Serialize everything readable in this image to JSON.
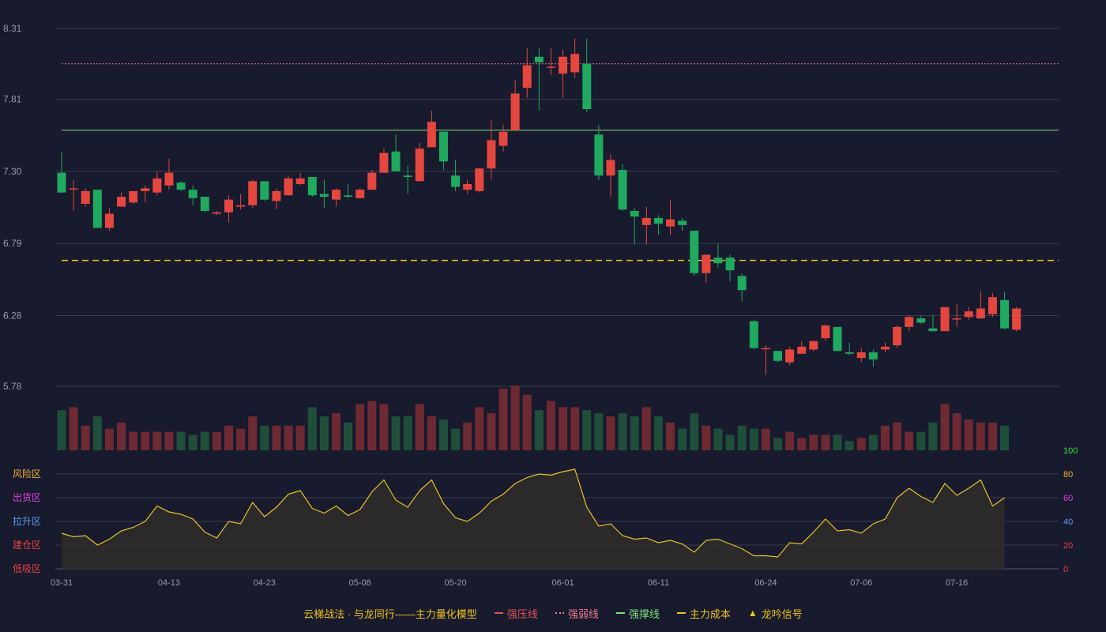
{
  "chart_data": {
    "type": "candlestick",
    "dates": [
      "03-31",
      "04-01",
      "04-02",
      "04-03",
      "04-07",
      "04-08",
      "04-09",
      "04-10",
      "04-11",
      "04-13",
      "04-14",
      "04-15",
      "04-16",
      "04-17",
      "04-18",
      "04-21",
      "04-22",
      "04-23",
      "04-24",
      "04-25",
      "04-28",
      "04-29",
      "04-30",
      "05-06",
      "05-07",
      "05-08",
      "05-09",
      "05-12",
      "05-13",
      "05-14",
      "05-15",
      "05-16",
      "05-19",
      "05-20",
      "05-21",
      "05-22",
      "05-23",
      "05-26",
      "05-27",
      "05-28",
      "05-29",
      "05-30",
      "06-01",
      "06-02",
      "06-03",
      "06-04",
      "06-05",
      "06-06",
      "06-09",
      "06-10",
      "06-11",
      "06-12",
      "06-13",
      "06-16",
      "06-17",
      "06-18",
      "06-19",
      "06-20",
      "06-23",
      "06-24",
      "06-25",
      "06-26",
      "06-27",
      "06-30",
      "07-01",
      "07-02",
      "07-03",
      "07-06",
      "07-07",
      "07-08",
      "07-09",
      "07-10",
      "07-13",
      "07-14",
      "07-15",
      "07-16",
      "07-17",
      "07-20",
      "07-21",
      "07-22",
      "07-23",
      "07-24",
      "07-27",
      "07-28"
    ],
    "x_tick_labels": [
      "03-31",
      "04-13",
      "04-23",
      "05-08",
      "05-20",
      "06-01",
      "06-11",
      "06-24",
      "07-06",
      "07-16"
    ],
    "price_axis_labels": [
      "8.31",
      "7.81",
      "7.30",
      "6.79",
      "6.28",
      "5.78"
    ],
    "price_ylim": [
      5.78,
      8.31
    ],
    "ohlc": [
      [
        7.29,
        7.15,
        7.44,
        7.15
      ],
      [
        7.18,
        7.18,
        7.24,
        7.02
      ],
      [
        7.07,
        7.16,
        7.18,
        7.05
      ],
      [
        7.17,
        6.9,
        7.17,
        6.9
      ],
      [
        6.9,
        7.0,
        7.04,
        6.88
      ],
      [
        7.05,
        7.12,
        7.15,
        7.05
      ],
      [
        7.08,
        7.16,
        7.16,
        7.07
      ],
      [
        7.16,
        7.18,
        7.2,
        7.08
      ],
      [
        7.15,
        7.25,
        7.3,
        7.13
      ],
      [
        7.2,
        7.29,
        7.39,
        7.17
      ],
      [
        7.22,
        7.17,
        7.23,
        7.16
      ],
      [
        7.17,
        7.11,
        7.2,
        7.06
      ],
      [
        7.12,
        7.02,
        7.12,
        7.01
      ],
      [
        7.0,
        7.01,
        7.02,
        6.99
      ],
      [
        7.01,
        7.1,
        7.13,
        6.94
      ],
      [
        7.05,
        7.06,
        7.14,
        7.03
      ],
      [
        7.06,
        7.23,
        7.24,
        7.04
      ],
      [
        7.23,
        7.1,
        7.23,
        7.09
      ],
      [
        7.09,
        7.16,
        7.18,
        7.03
      ],
      [
        7.13,
        7.25,
        7.27,
        7.13
      ],
      [
        7.21,
        7.25,
        7.29,
        7.2
      ],
      [
        7.26,
        7.13,
        7.26,
        7.12
      ],
      [
        7.14,
        7.12,
        7.24,
        7.04
      ],
      [
        7.1,
        7.17,
        7.18,
        7.05
      ],
      [
        7.13,
        7.12,
        7.21,
        7.11
      ],
      [
        7.11,
        7.17,
        7.18,
        7.11
      ],
      [
        7.17,
        7.29,
        7.31,
        7.17
      ],
      [
        7.29,
        7.43,
        7.46,
        7.29
      ],
      [
        7.44,
        7.3,
        7.56,
        7.3
      ],
      [
        7.27,
        7.26,
        7.34,
        7.14
      ],
      [
        7.23,
        7.46,
        7.5,
        7.23
      ],
      [
        7.47,
        7.65,
        7.73,
        7.47
      ],
      [
        7.58,
        7.37,
        7.58,
        7.31
      ],
      [
        7.27,
        7.19,
        7.38,
        7.16
      ],
      [
        7.17,
        7.21,
        7.24,
        7.14
      ],
      [
        7.16,
        7.32,
        7.32,
        7.15
      ],
      [
        7.32,
        7.52,
        7.66,
        7.24
      ],
      [
        7.48,
        7.58,
        7.63,
        7.44
      ],
      [
        7.59,
        7.85,
        7.95,
        7.59
      ],
      [
        7.89,
        8.05,
        8.17,
        7.82
      ],
      [
        8.11,
        8.07,
        8.17,
        7.73
      ],
      [
        8.04,
        8.04,
        8.17,
        7.98
      ],
      [
        7.99,
        8.11,
        8.16,
        7.82
      ],
      [
        8.0,
        8.13,
        8.24,
        7.96
      ],
      [
        8.06,
        7.74,
        8.24,
        7.72
      ],
      [
        7.56,
        7.27,
        7.63,
        7.24
      ],
      [
        7.27,
        7.38,
        7.42,
        7.12
      ],
      [
        7.31,
        7.03,
        7.35,
        7.02
      ],
      [
        7.02,
        6.98,
        7.04,
        6.78
      ],
      [
        6.92,
        6.97,
        7.05,
        6.78
      ],
      [
        6.97,
        6.93,
        6.99,
        6.85
      ],
      [
        6.91,
        6.96,
        7.1,
        6.85
      ],
      [
        6.95,
        6.92,
        6.97,
        6.88
      ],
      [
        6.88,
        6.58,
        6.88,
        6.56
      ],
      [
        6.58,
        6.71,
        6.71,
        6.51
      ],
      [
        6.69,
        6.65,
        6.79,
        6.62
      ],
      [
        6.69,
        6.6,
        6.71,
        6.52
      ],
      [
        6.56,
        6.46,
        6.58,
        6.38
      ],
      [
        6.24,
        6.05,
        6.25,
        6.04
      ],
      [
        6.05,
        6.05,
        6.07,
        5.86
      ],
      [
        6.03,
        5.96,
        6.03,
        5.95
      ],
      [
        5.95,
        6.04,
        6.06,
        5.93
      ],
      [
        6.01,
        6.06,
        6.1,
        6.01
      ],
      [
        6.04,
        6.1,
        6.1,
        6.03
      ],
      [
        6.12,
        6.21,
        6.22,
        6.1
      ],
      [
        6.2,
        6.03,
        6.2,
        6.03
      ],
      [
        6.02,
        6.01,
        6.09,
        6.0
      ],
      [
        5.98,
        6.02,
        6.05,
        5.95
      ],
      [
        6.02,
        5.97,
        6.04,
        5.92
      ],
      [
        6.04,
        6.06,
        6.09,
        6.02
      ],
      [
        6.07,
        6.2,
        6.21,
        6.05
      ],
      [
        6.2,
        6.27,
        6.28,
        6.17
      ],
      [
        6.26,
        6.23,
        6.28,
        6.22
      ],
      [
        6.19,
        6.17,
        6.28,
        6.17
      ],
      [
        6.17,
        6.34,
        6.34,
        6.17
      ],
      [
        6.26,
        6.26,
        6.36,
        6.2
      ],
      [
        6.27,
        6.31,
        6.34,
        6.25
      ],
      [
        6.26,
        6.33,
        6.45,
        6.26
      ],
      [
        6.29,
        6.41,
        6.44,
        6.27
      ],
      [
        6.39,
        6.19,
        6.45,
        6.18
      ],
      [
        6.18,
        6.33,
        6.34,
        6.17
      ]
    ],
    "volume": [
      13,
      14,
      8,
      11,
      7,
      9,
      6,
      6,
      6,
      6,
      6,
      5,
      6,
      6,
      8,
      7,
      11,
      8,
      8,
      8,
      8,
      14,
      11,
      12,
      9,
      15,
      16,
      15,
      11,
      11,
      15,
      11,
      10,
      7,
      9,
      14,
      12,
      20,
      21,
      18,
      13,
      16,
      14,
      14,
      13,
      12,
      11,
      12,
      11,
      14,
      11,
      9,
      7,
      12,
      8,
      7,
      5,
      8,
      7,
      7,
      4,
      6,
      4,
      5,
      5,
      5,
      3,
      4,
      5,
      8,
      9,
      6,
      6,
      9,
      15,
      12,
      10,
      9,
      9,
      8
    ],
    "oscillator": {
      "axis_values": [
        0,
        20,
        40,
        60,
        80,
        100
      ],
      "zone_labels": [
        "风险区",
        "出货区",
        "拉升区",
        "建仓区",
        "低吸区"
      ],
      "values": [
        30,
        27,
        28,
        20,
        25,
        32,
        35,
        40,
        53,
        48,
        46,
        42,
        31,
        26,
        40,
        38,
        56,
        44,
        52,
        63,
        66,
        51,
        47,
        53,
        45,
        50,
        65,
        75,
        58,
        52,
        66,
        75,
        55,
        43,
        40,
        47,
        57,
        63,
        72,
        77,
        80,
        79,
        82,
        84,
        52,
        36,
        38,
        28,
        25,
        26,
        22,
        24,
        21,
        14,
        24,
        25,
        21,
        17,
        11,
        11,
        10,
        22,
        21,
        31,
        42,
        32,
        33,
        30,
        38,
        42,
        60,
        68,
        61,
        56,
        72,
        62,
        68,
        75,
        53,
        60
      ]
    },
    "lines": {
      "strong_pressure": 8.06,
      "strong_support": 7.59,
      "main_cost": 6.67
    },
    "legend": [
      {
        "label": "强压线",
        "style": "solid",
        "color": "#e05555"
      },
      {
        "label": "强弱线",
        "style": "dotted",
        "color": "#ee7b8c"
      },
      {
        "label": "强撑线",
        "style": "solid",
        "color": "#7be07b"
      },
      {
        "label": "主力成本",
        "style": "dashed",
        "color": "#f0c419"
      },
      {
        "label": "龙吟信号",
        "style": "triangle",
        "color": "#f0c419"
      }
    ],
    "model_title": "云梯战法 · 与龙同行——主力量化模型"
  },
  "colors": {
    "up": "#e5473e",
    "down": "#1faa60",
    "volume_up": "#6e2a32",
    "volume_down": "#1f4f3b",
    "grid": "#3a3c4e",
    "axis_text": "#9a9aa8",
    "oscillator_line": "#e6c229",
    "oscillator_fill": "#2d2a2a",
    "pressure_line": "#ee7b8c",
    "support_line": "#7be07b",
    "cost_line": "#f0c419",
    "zone_colors": [
      "#f0b030",
      "#e040e0",
      "#5a9cf0",
      "#e84040",
      "#e84040"
    ],
    "right_axis_colors": [
      "#e84040",
      "#e84040",
      "#5a9cf0",
      "#e040e0",
      "#f0b030",
      "#2ee42e"
    ]
  }
}
